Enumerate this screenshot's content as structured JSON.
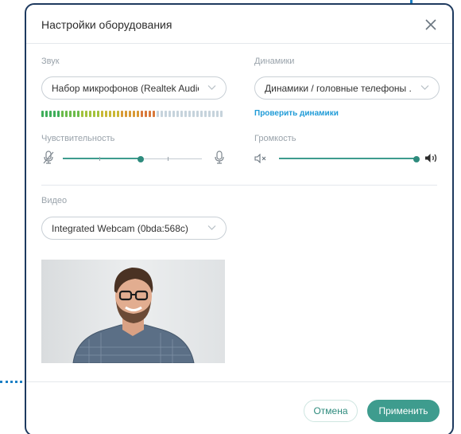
{
  "dialog": {
    "title": "Настройки оборудования"
  },
  "sound": {
    "label": "Звук",
    "microphone": "Набор микрофонов (Realtek Audio)",
    "level_fraction": 0.64,
    "sensitivity_label": "Чувствительность",
    "sensitivity_fraction": 0.56
  },
  "speakers": {
    "label": "Динамики",
    "device": "Динамики / головные телефоны ...",
    "test_link": "Проверить динамики",
    "volume_label": "Громкость",
    "volume_fraction": 1.0
  },
  "video": {
    "label": "Видео",
    "camera": "Integrated Webcam (0bda:568c)"
  },
  "footer": {
    "cancel_label": "Отмена",
    "apply_label": "Применить"
  },
  "colors": {
    "accent": "#3e9c8e",
    "link": "#1f9bd7",
    "border": "#1e3a5f",
    "marker": "#1b7fc4"
  }
}
